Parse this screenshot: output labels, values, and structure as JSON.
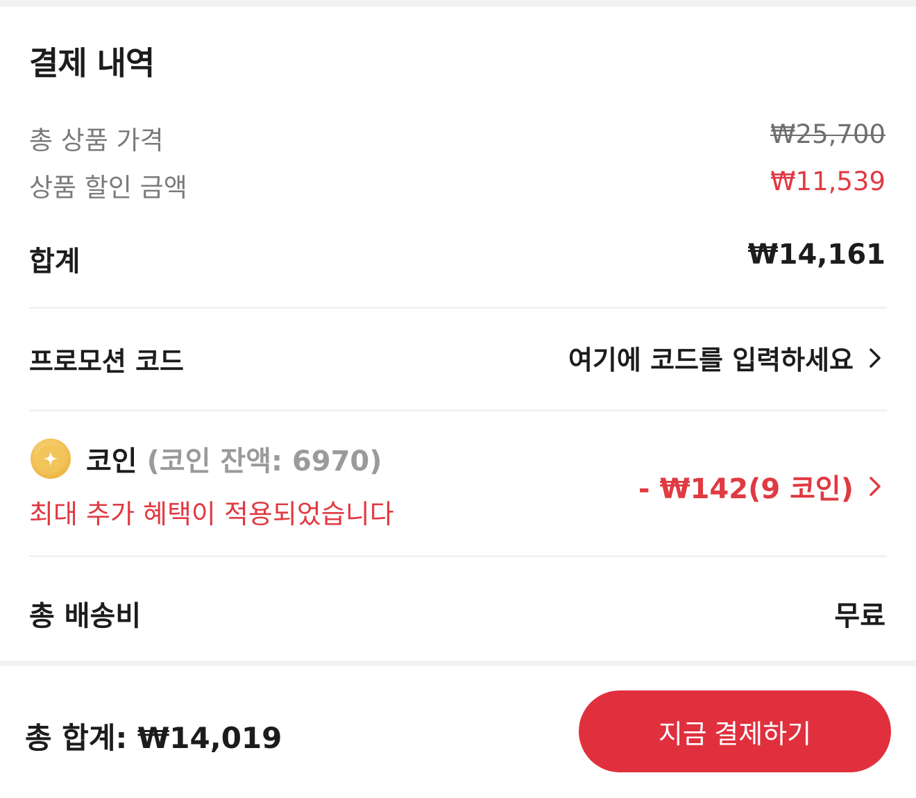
{
  "summary": {
    "title": "결제 내역",
    "total_product_price_label": "총 상품 가격",
    "total_product_price": "₩25,700",
    "product_discount_label": "상품 할인 금액",
    "product_discount": "₩11,539",
    "subtotal_label": "합계",
    "subtotal": "₩14,161"
  },
  "promo": {
    "label": "프로모션 코드",
    "placeholder": "여기에 코드를 입력하세요",
    "icon": "chevron-right-icon"
  },
  "coin": {
    "icon": "coin-icon",
    "label": "코인",
    "balance": "(코인 잔액: 6970)",
    "note": "최대 추가 혜택이 적용되었습니다",
    "amount": "- ₩142(9 코인)"
  },
  "shipping": {
    "label": "총 배송비",
    "value": "무료"
  },
  "footer": {
    "total": "총 합계: ₩14,019",
    "pay_button": "지금 결제하기"
  },
  "colors": {
    "accent_red": "#e0303e",
    "discount_red": "#e03a42",
    "coin_gold": "#f5c451"
  }
}
